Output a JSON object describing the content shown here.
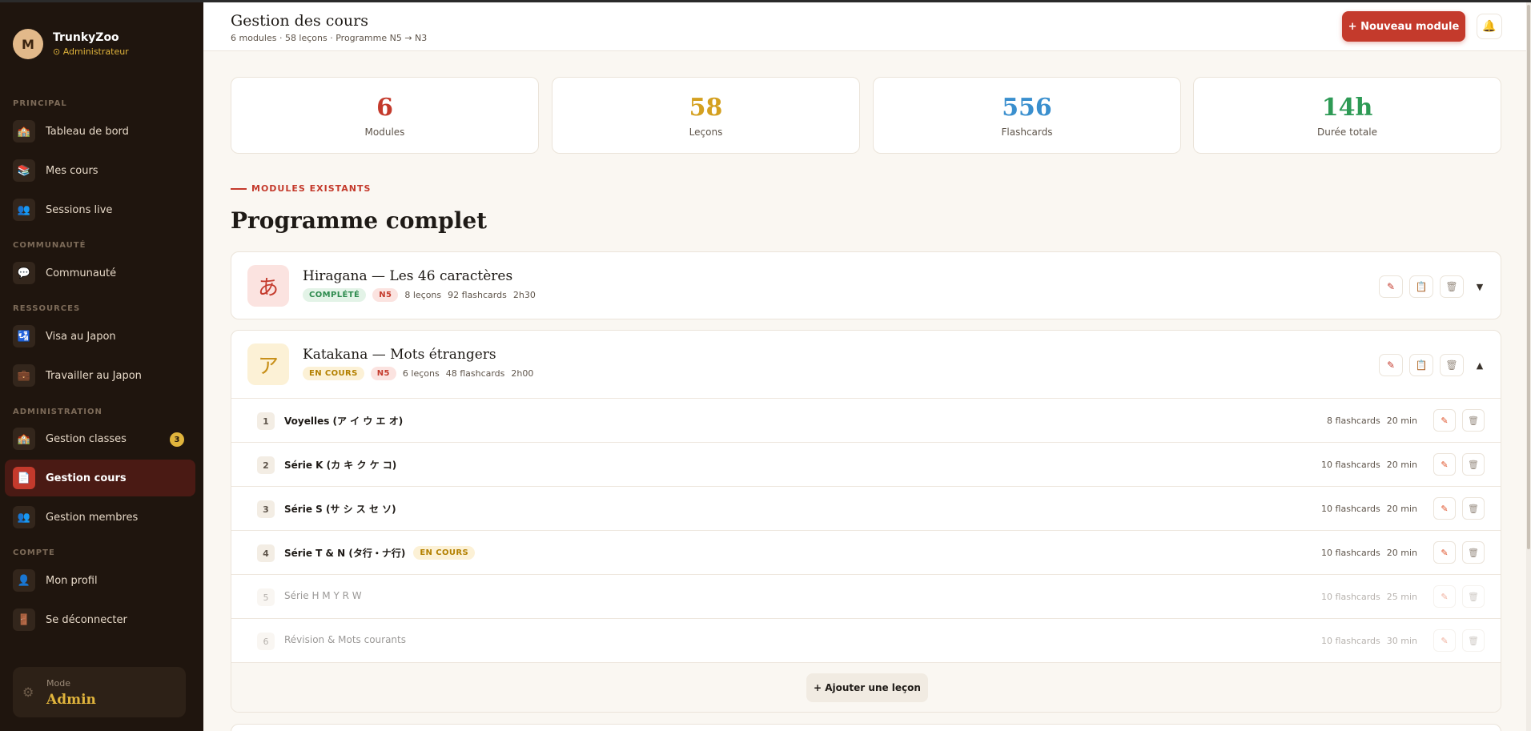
{
  "sidebar": {
    "user": {
      "initial": "M",
      "name": "TrunkyZoo",
      "role": "⊙ Administrateur"
    },
    "sections": {
      "principal": "PRINCIPAL",
      "communaute": "COMMUNAUTÉ",
      "ressources": "RESSOURCES",
      "administration": "ADMINISTRATION",
      "compte": "COMPTE"
    },
    "items": [
      {
        "label": "Tableau de bord",
        "icon": "🏫"
      },
      {
        "label": "Mes cours",
        "icon": "📚"
      },
      {
        "label": "Sessions live",
        "icon": "👥"
      },
      {
        "label": "Communauté",
        "icon": "💬"
      },
      {
        "label": "Visa au Japon",
        "icon": "🛂"
      },
      {
        "label": "Travailler au Japon",
        "icon": "💼"
      },
      {
        "label": "Gestion classes",
        "icon": "🏫",
        "badge": "3"
      },
      {
        "label": "Gestion cours",
        "icon": "📄"
      },
      {
        "label": "Gestion membres",
        "icon": "👥"
      },
      {
        "label": "Mon profil",
        "icon": "👤"
      },
      {
        "label": "Se déconnecter",
        "icon": "🚪"
      }
    ],
    "mode": {
      "label": "Mode",
      "value": "Admin",
      "icon": "⚙"
    }
  },
  "header": {
    "title": "Gestion des cours",
    "subtitle": "6 modules · 58 leçons · Programme N5 → N3",
    "new_button": "+ Nouveau module",
    "bell_icon": "🔔"
  },
  "stats": [
    {
      "value": "6",
      "label": "Modules",
      "color": "#c43a2c"
    },
    {
      "value": "58",
      "label": "Leçons",
      "color": "#d4a020"
    },
    {
      "value": "556",
      "label": "Flashcards",
      "color": "#3a8fce"
    },
    {
      "value": "14h",
      "label": "Durée totale",
      "color": "#2e9a55"
    }
  ],
  "section": {
    "eyebrow": "MODULES EXISTANTS",
    "title": "Programme complet"
  },
  "modules": [
    {
      "glyph": "あ",
      "title": "Hiragana — Les 46 caractères",
      "status": "COMPLÉTÉ",
      "level": "N5",
      "lessons": "8 leçons",
      "flashcards": "92 flashcards",
      "duration": "2h30",
      "chevron": "▼"
    },
    {
      "glyph": "ア",
      "title": "Katakana — Mots étrangers",
      "status": "EN COURS",
      "level": "N5",
      "lessons": "6 leçons",
      "flashcards": "48 flashcards",
      "duration": "2h00",
      "chevron": "▲",
      "lesson_rows": [
        {
          "num": "1",
          "title": "Voyelles (ア イ ウ エ オ)",
          "flashcards": "8 flashcards",
          "duration": "20 min"
        },
        {
          "num": "2",
          "title": "Série K (カ キ ク ケ コ)",
          "flashcards": "10 flashcards",
          "duration": "20 min"
        },
        {
          "num": "3",
          "title": "Série S (サ シ ス セ ソ)",
          "flashcards": "10 flashcards",
          "duration": "20 min"
        },
        {
          "num": "4",
          "title": "Série T & N (タ行・ナ行)",
          "badge": "EN COURS",
          "flashcards": "10 flashcards",
          "duration": "20 min"
        },
        {
          "num": "5",
          "title": "Série H M Y R W",
          "flashcards": "10 flashcards",
          "duration": "25 min"
        },
        {
          "num": "6",
          "title": "Révision & Mots courants",
          "flashcards": "10 flashcards",
          "duration": "30 min"
        }
      ],
      "add_lesson": "+ Ajouter une leçon"
    }
  ],
  "icons": {
    "edit": "✎",
    "list": "📋",
    "delete": "🗑"
  }
}
